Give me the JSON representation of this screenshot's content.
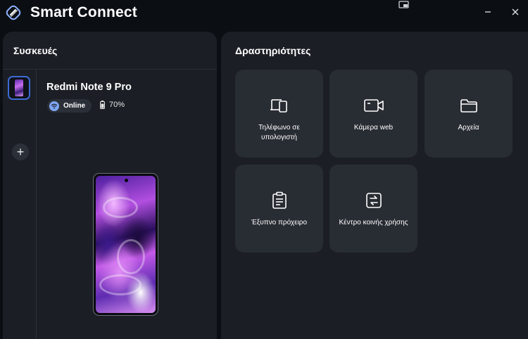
{
  "app": {
    "title": "Smart Connect"
  },
  "devices_panel": {
    "title": "Συσκευές",
    "device": {
      "name": "Redmi Note 9 Pro",
      "status": "Online",
      "battery": "70%"
    },
    "add_label": "+"
  },
  "activities_panel": {
    "title": "Δραστηριότητες",
    "tiles": [
      {
        "label": "Τηλέφωνο σε υπολογιστή",
        "icon": "phone-to-pc-icon"
      },
      {
        "label": "Κάμερα web",
        "icon": "webcam-icon"
      },
      {
        "label": "Αρχεία",
        "icon": "folder-icon"
      },
      {
        "label": "Έξυπνο πρόχειρο",
        "icon": "clipboard-icon"
      },
      {
        "label": "Κέντρο κοινής χρήσης",
        "icon": "share-center-icon"
      }
    ]
  },
  "colors": {
    "background": "#0b0f14",
    "panel": "#1b1f25",
    "tile": "#282c33",
    "accent": "#3d6bd6",
    "wifi": "#7ea6f5"
  }
}
